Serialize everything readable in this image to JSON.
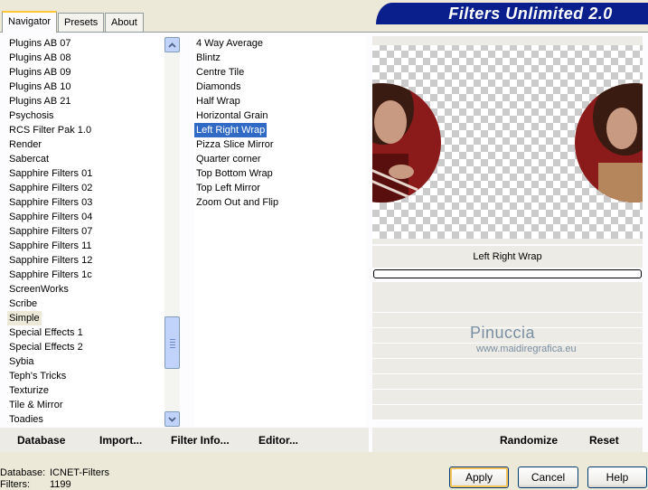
{
  "tabs": [
    "Navigator",
    "Presets",
    "About"
  ],
  "app_title": "Filters Unlimited 2.0",
  "categories": [
    "Plugins AB 07",
    "Plugins AB 08",
    "Plugins AB 09",
    "Plugins AB 10",
    "Plugins AB 21",
    "Psychosis",
    "RCS Filter Pak 1.0",
    "Render",
    "Sabercat",
    "Sapphire Filters 01",
    "Sapphire Filters 02",
    "Sapphire Filters 03",
    "Sapphire Filters 04",
    "Sapphire Filters 07",
    "Sapphire Filters 11",
    "Sapphire Filters 12",
    "Sapphire Filters 1c",
    "ScreenWorks",
    "Scribe",
    "Simple",
    "Special Effects 1",
    "Special Effects 2",
    "Sybia",
    "Teph's Tricks",
    "Texturize",
    "Tile & Mirror",
    "Toadies"
  ],
  "selected_category": "Simple",
  "filters": [
    "4 Way Average",
    "Blintz",
    "Centre Tile",
    "Diamonds",
    "Half Wrap",
    "Horizontal Grain",
    "Left Right Wrap",
    "Pizza Slice Mirror",
    "Quarter corner",
    "Top Bottom Wrap",
    "Top Left Mirror",
    "Zoom Out and Flip"
  ],
  "selected_filter": "Left Right Wrap",
  "preview_filter_name": "Left Right Wrap",
  "watermark": {
    "name": "Pinuccia",
    "site": "www.maidiregrafica.eu"
  },
  "bottom_links": {
    "database": "Database",
    "import": "Import...",
    "filter_info": "Filter Info...",
    "editor": "Editor...",
    "randomize": "Randomize",
    "reset": "Reset"
  },
  "status": {
    "database_label": "Database:",
    "database_value": "ICNET-Filters",
    "filters_label": "Filters:",
    "filters_value": "1199"
  },
  "buttons": {
    "apply": "Apply",
    "cancel": "Cancel",
    "help": "Help"
  },
  "colors": {
    "selection": "#316ac5",
    "title_band": "#0a1f8c",
    "preview_red": "#8b1a1a"
  }
}
